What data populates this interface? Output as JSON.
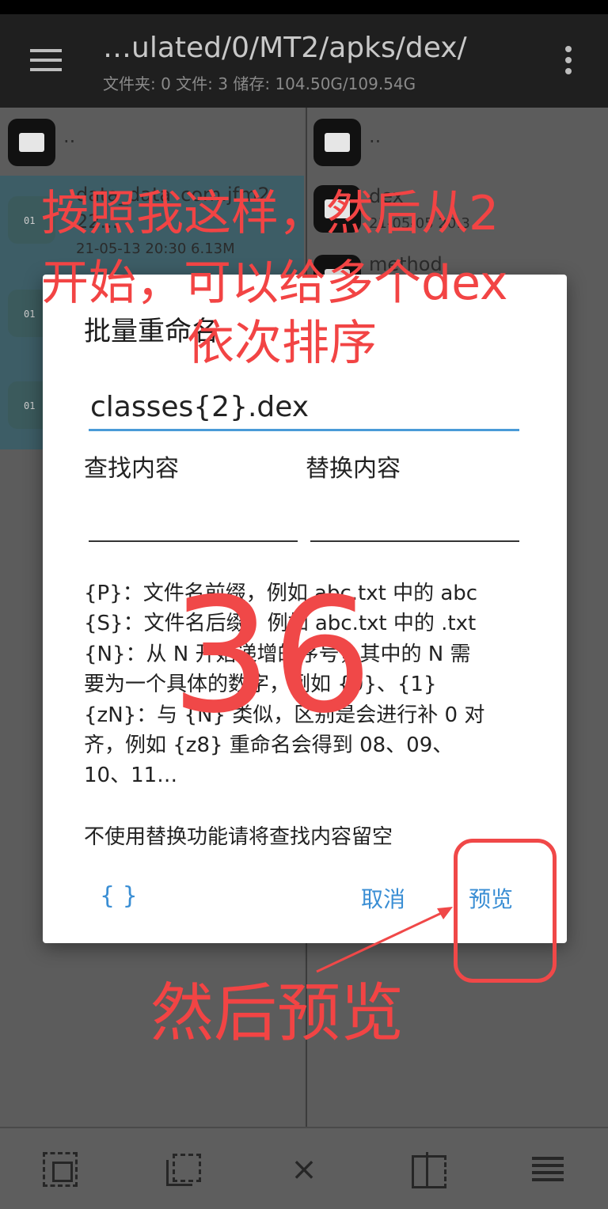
{
  "toolbar": {
    "path": "…ulated/0/MT2/apks/dex/",
    "stats": "文件夹: 0  文件: 3  储存: 104.50G/109.54G"
  },
  "left_pane": {
    "parent": "..",
    "file_name": "data_data_com.jfm2",
    "file_name_2": "22...",
    "file_meta": "21-05-13 20:30  6.13M"
  },
  "right_pane": {
    "parent": "..",
    "folder_name": "dex",
    "folder_meta": "21-05-05 20:3",
    "folder2_name": "method"
  },
  "dialog": {
    "title": "批量重命名",
    "name_value": "classes{2}.dex",
    "find_label": "查找内容",
    "replace_label": "替换内容",
    "find_value": "",
    "replace_value": "",
    "help_lines": [
      "{P}：文件名前缀，例如 abc.txt 中的 abc",
      "{S}：文件名后缀，例如 abc.txt 中的 .txt",
      "{N}：从 N 开始递增的序号，其中的 N 需",
      "要为一个具体的数字，例如 {0}、{1}",
      "{zN}：与 {N} 类似，区别是会进行补 0 对",
      "齐，例如 {z8} 重命名会得到 08、09、",
      "10、11…"
    ],
    "note": "不使用替换功能请将查找内容留空",
    "braces_label": "{ }",
    "cancel_label": "取消",
    "preview_label": "预览"
  },
  "annotations": {
    "line1": "按照我这样，然后从2",
    "line2": "开始，可以给多个dex",
    "line3": "依次排序",
    "number": "36",
    "line4": "然后预览",
    "color": "#f24444"
  },
  "colors": {
    "accent": "#3a8ed4",
    "input_underline": "#4a9bd8",
    "toolbar_bg": "#1f1f1f"
  },
  "bottombar": {
    "icons": [
      "select-all-icon",
      "select-partial-icon",
      "close-icon",
      "compare-icon",
      "list-select-icon"
    ],
    "close_glyph": "×"
  }
}
